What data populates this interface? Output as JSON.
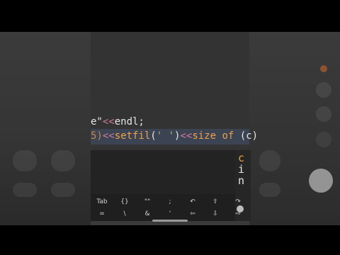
{
  "code": {
    "line1": {
      "text_a": "e\"",
      "text_b": "<<",
      "text_c": "endl;"
    },
    "line2": {
      "num": "5)",
      "op1": "<<",
      "fn": "setfil",
      "paren_open": "(",
      "str": "' '",
      "paren_close": ")",
      "op2": "<<",
      "ident": "size",
      "kw": " of ",
      "arg": "(c)"
    }
  },
  "side_suggestions": [
    "c",
    "i",
    "n"
  ],
  "keyboard": {
    "row1": [
      "Tab",
      "{}",
      "\"\"",
      ";",
      "↶",
      "⇧",
      "↷"
    ],
    "row2": [
      "=",
      "\\",
      "&",
      "'",
      "⇦",
      "⇩",
      "⇨"
    ]
  },
  "colors": {
    "keyword": "#e6a04a",
    "operator": "#d07a9c",
    "highlight": "#3c4352",
    "editor_bg": "#333333"
  }
}
